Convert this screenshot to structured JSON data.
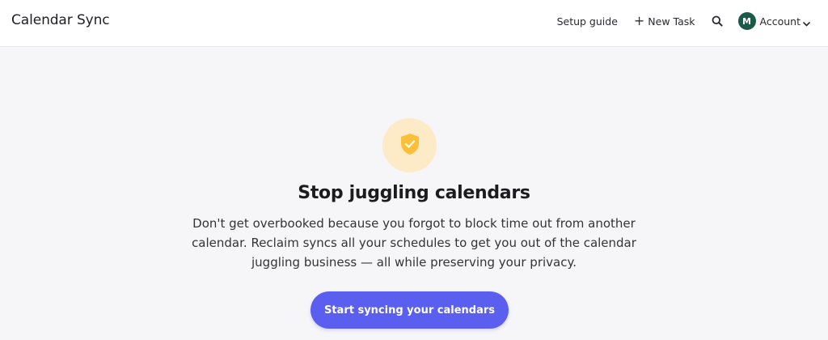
{
  "header": {
    "app_title": "Calendar Sync",
    "setup_guide": "Setup guide",
    "new_task": "New Task",
    "account_initial": "M",
    "account_label": "Account"
  },
  "hero": {
    "title": "Stop juggling calendars",
    "description": "Don't get overbooked because you forgot to block time out from another calendar. Reclaim syncs all your schedules to get you out of the calendar juggling business — all while preserving your privacy.",
    "cta_label": "Start syncing your calendars",
    "icon": "shield-check-icon"
  },
  "colors": {
    "accent": "#5a5ff0",
    "avatar_bg": "#1b5a48",
    "shield": "#fbbf3a",
    "shield_circle": "#fdebc8",
    "background": "#f6f6f9"
  }
}
